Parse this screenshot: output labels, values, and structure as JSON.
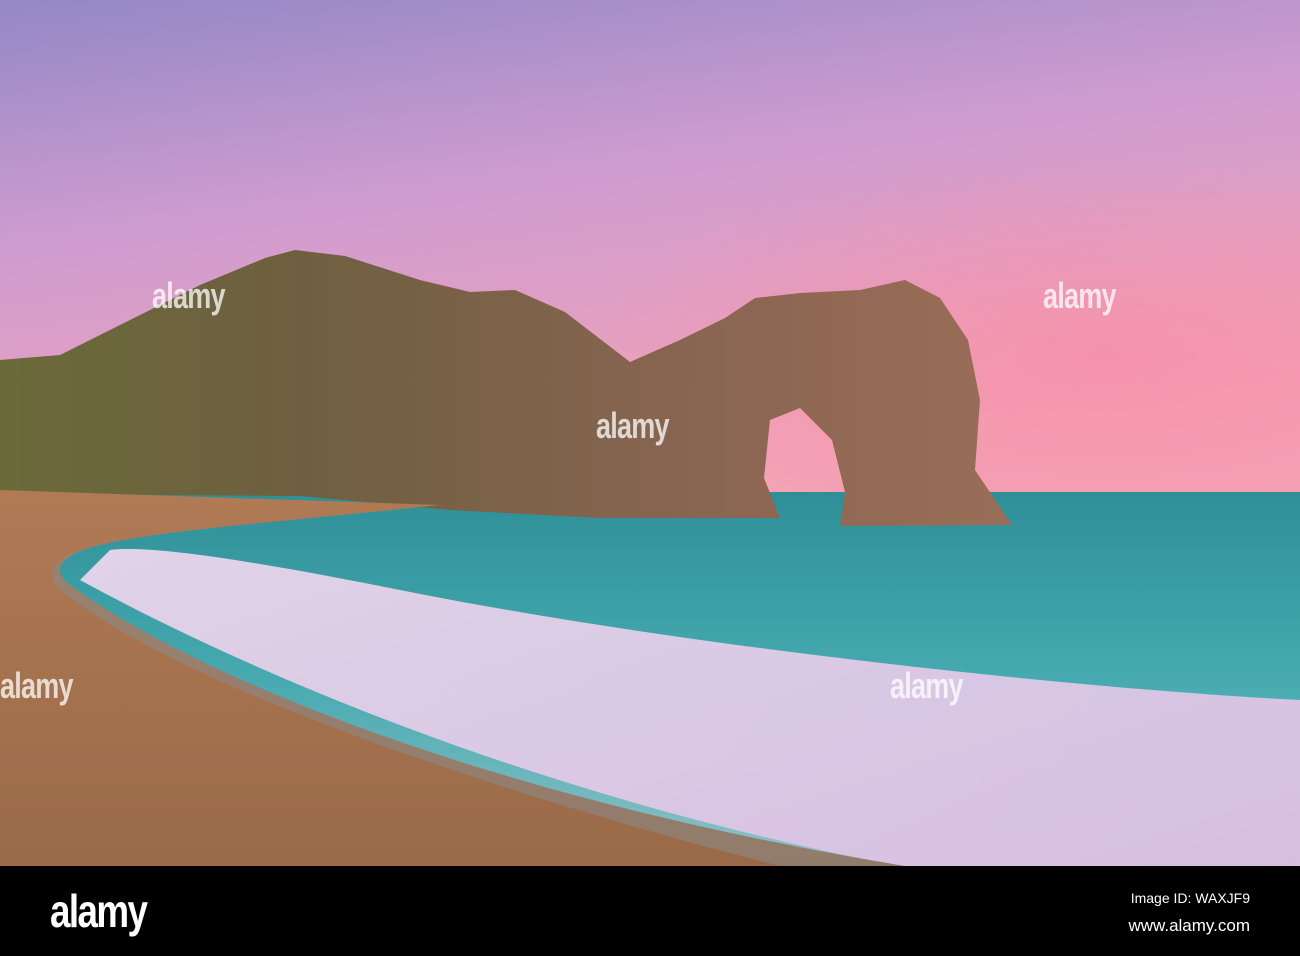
{
  "image": {
    "subject": "Sea arch on a pebble beach at sunset",
    "colors": {
      "sky_top": "#9a8cc8",
      "sky_pink": "#f0a0b8",
      "sea": "#3fa3a8",
      "rock": "#7a5a48",
      "beach": "#a5734e"
    }
  },
  "watermark": {
    "text": "alamy"
  },
  "footer": {
    "logo": "alamy",
    "image_id": "Image ID: WAXJF9",
    "url": "www.alamy.com"
  }
}
